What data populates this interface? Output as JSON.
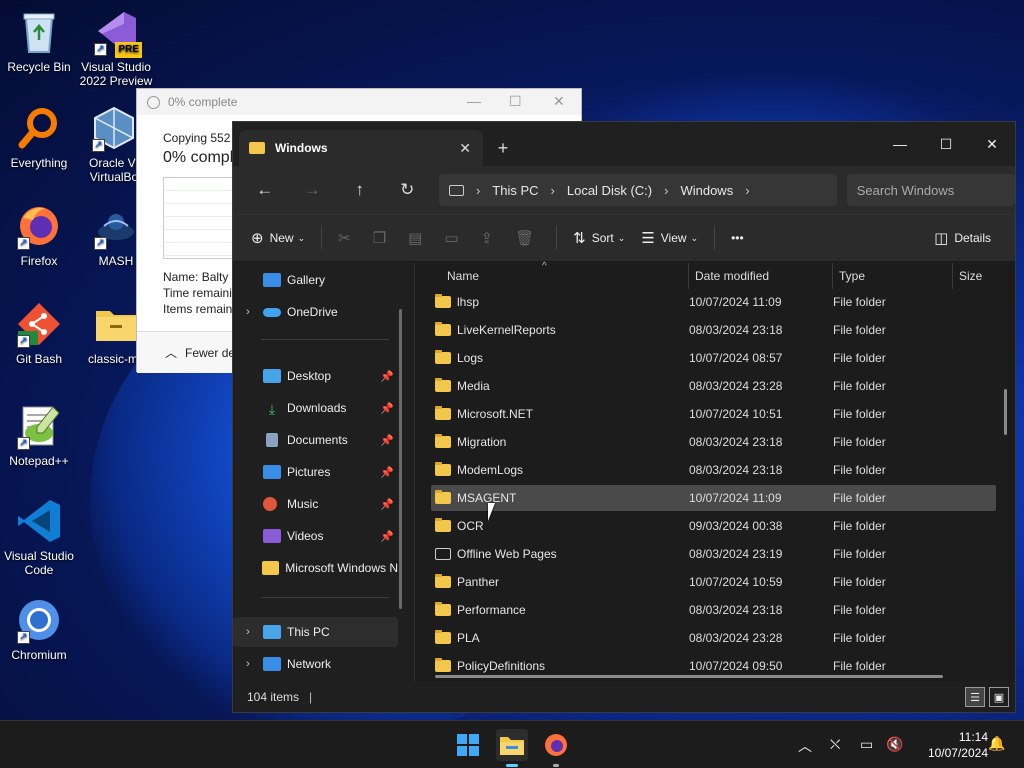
{
  "desktop": {
    "icons": [
      {
        "label": "Recycle Bin",
        "icon": "recycle-bin-icon"
      },
      {
        "label": "Visual Studio 2022 Preview",
        "icon": "visual-studio-preview-icon",
        "badge": "PRE"
      },
      {
        "label": "Everything",
        "icon": "everything-search-icon"
      },
      {
        "label": "Oracle VM VirtualBox",
        "label_visible": "Oracle VI VirtualBo",
        "icon": "virtualbox-icon"
      },
      {
        "label": "Firefox",
        "icon": "firefox-icon"
      },
      {
        "label": "MASH",
        "icon": "mash-icon"
      },
      {
        "label": "Git Bash",
        "icon": "git-bash-icon"
      },
      {
        "label": "classic-ms",
        "icon": "folder-icon"
      },
      {
        "label": "Notepad++",
        "icon": "notepad-plus-plus-icon"
      },
      {
        "label": "Visual Studio Code",
        "icon": "vscode-icon"
      },
      {
        "label": "Chromium",
        "icon": "chromium-icon"
      }
    ]
  },
  "copy_dialog": {
    "title": "0% complete",
    "copying": "Copying 552",
    "percent": "0% compl",
    "name_label": "Name:",
    "name_value": "Balty",
    "time_remaining": "Time remaini",
    "items_remaining": "Items remain",
    "fewer_details": "Fewer de",
    "progress_percent": 0
  },
  "explorer": {
    "tab_title": "Windows",
    "breadcrumb": [
      "This PC",
      "Local Disk (C:)",
      "Windows"
    ],
    "search_placeholder": "Search Windows",
    "commands": {
      "new": "New",
      "sort": "Sort",
      "view": "View",
      "more": "•••",
      "details": "Details"
    },
    "nav": {
      "gallery": "Gallery",
      "onedrive": "OneDrive",
      "desktop": "Desktop",
      "downloads": "Downloads",
      "documents": "Documents",
      "pictures": "Pictures",
      "music": "Music",
      "videos": "Videos",
      "mswindows": "Microsoft Windows N",
      "thispc": "This PC",
      "network": "Network"
    },
    "columns": {
      "name": "Name",
      "date": "Date modified",
      "type": "Type",
      "size": "Size"
    },
    "files": [
      {
        "name": "lhsp",
        "date": "10/07/2024 11:09",
        "type": "File folder"
      },
      {
        "name": "LiveKernelReports",
        "date": "08/03/2024 23:18",
        "type": "File folder"
      },
      {
        "name": "Logs",
        "date": "10/07/2024 08:57",
        "type": "File folder"
      },
      {
        "name": "Media",
        "date": "08/03/2024 23:28",
        "type": "File folder"
      },
      {
        "name": "Microsoft.NET",
        "date": "10/07/2024 10:51",
        "type": "File folder"
      },
      {
        "name": "Migration",
        "date": "08/03/2024 23:18",
        "type": "File folder"
      },
      {
        "name": "ModemLogs",
        "date": "08/03/2024 23:18",
        "type": "File folder"
      },
      {
        "name": "MSAGENT",
        "date": "10/07/2024 11:09",
        "type": "File folder"
      },
      {
        "name": "OCR",
        "date": "09/03/2024 00:38",
        "type": "File folder"
      },
      {
        "name": "Offline Web Pages",
        "date": "08/03/2024 23:19",
        "type": "File folder"
      },
      {
        "name": "Panther",
        "date": "10/07/2024 10:59",
        "type": "File folder"
      },
      {
        "name": "Performance",
        "date": "08/03/2024 23:18",
        "type": "File folder"
      },
      {
        "name": "PLA",
        "date": "08/03/2024 23:28",
        "type": "File folder"
      },
      {
        "name": "PolicyDefinitions",
        "date": "10/07/2024 09:50",
        "type": "File folder"
      }
    ],
    "status": "104 items"
  },
  "taskbar": {
    "time": "11:14",
    "date": "10/07/2024"
  },
  "colors": {
    "folder": "#f3c74a",
    "accent": "#0078d4"
  }
}
